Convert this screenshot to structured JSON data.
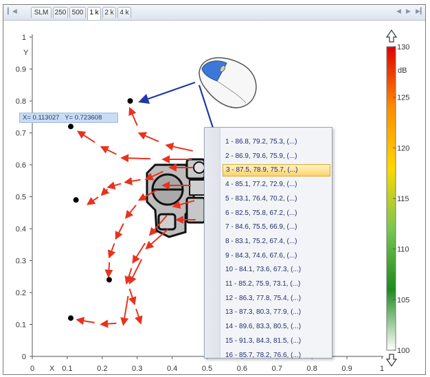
{
  "tabs": {
    "items": [
      {
        "label": "SLM",
        "active": false
      },
      {
        "label": "250",
        "active": false
      },
      {
        "label": "500",
        "active": false
      },
      {
        "label": "1 k",
        "active": true
      },
      {
        "label": "2 k",
        "active": false
      },
      {
        "label": "4 k",
        "active": false
      }
    ],
    "nav_first_icon": "first-icon",
    "nav_prev_icon": "prev-icon",
    "nav_next_icon": "next-icon",
    "nav_last_icon": "last-icon"
  },
  "plot": {
    "x_axis_label": "X",
    "y_axis_label": "Y",
    "x_ticks": [
      "0",
      "0.1",
      "0.2",
      "0.3",
      "0.4",
      "0.5",
      "0.6",
      "0.7",
      "0.8",
      "0.9",
      "1"
    ],
    "y_ticks": [
      "0",
      "0.1",
      "0.2",
      "0.3",
      "0.4",
      "0.5",
      "0.6",
      "0.7",
      "0.8",
      "0.9",
      "1"
    ],
    "points": [
      {
        "x": 0.28,
        "y": 0.8
      },
      {
        "x": 0.11,
        "y": 0.72
      },
      {
        "x": 0.125,
        "y": 0.49
      },
      {
        "x": 0.22,
        "y": 0.24
      },
      {
        "x": 0.11,
        "y": 0.12
      }
    ],
    "arrow_color": "#e8321e",
    "marker_color": "#000000"
  },
  "readout": {
    "x_text": "X= 0.113027",
    "y_text": "Y= 0.723608"
  },
  "colorbar": {
    "unit": "dB",
    "min": 100,
    "max": 130,
    "tick_labels": [
      "130",
      "125",
      "120",
      "115",
      "110",
      "105",
      "100"
    ],
    "colors": [
      "#e00000",
      "#ff8c00",
      "#ffd700",
      "#7ac74f",
      "#1e8a1e",
      "#ffffff"
    ],
    "scroll_up_icon": "arrow-up-icon",
    "scroll_down_icon": "arrow-down-icon"
  },
  "context_menu": {
    "items": [
      "1 - 86.8, 79.2, 75.3,  (...)",
      "2 - 86.9, 79.6, 75.9,  (...)",
      "3 - 87.5, 78.9, 75.7,  (...)",
      "4 - 85.1, 77.2, 72.9,  (...)",
      "5 - 83.1, 76.4, 70.2,  (...)",
      "6 - 82.5, 75.8, 67.2,  (...)",
      "7 - 84.6, 75.5, 66.9,  (...)",
      "8 - 83.1, 75.2, 67.4,  (...)",
      "9 - 84.3, 74.6, 67.6,  (...)",
      "10 - 84.1, 73.6, 67.3,  (...)",
      "11 - 85.2, 75.9, 73.1,  (...)",
      "12 - 86.3, 77.8, 75.4,  (...)",
      "13 - 87.3, 80.3, 77.9,  (...)",
      "14 - 89.6, 83.3, 80.5,  (...)",
      "15 - 91.3, 84.3, 81.5,  (...)",
      "16 - 85.7, 78.2, 76.6,  (...)"
    ],
    "selected_index": 2
  },
  "icons": {
    "mouse": "mouse-icon",
    "machine": "machine-icon"
  }
}
